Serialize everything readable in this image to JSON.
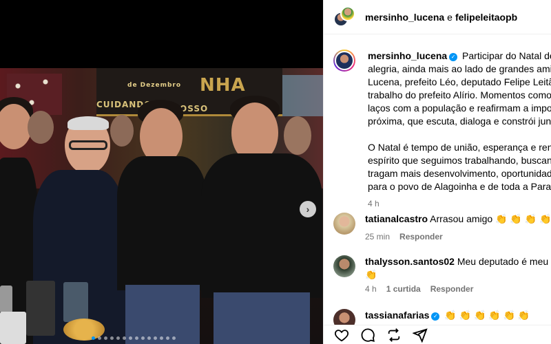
{
  "header": {
    "user1": "mersinho_lucena",
    "conj": "e",
    "user2": "felipeleitaopb"
  },
  "post": {
    "banner_words": [
      "NHA",
      "de Dezembro",
      "CUIDANDO",
      "NOSSO"
    ],
    "caption_username": "mersinho_lucena",
    "caption_lines": [
      "Participar do Natal de Ala",
      "alegria, ainda mais ao lado de grandes amigo",
      "Lucena, prefeito Léo, deputado Felipe Leitão p",
      "trabalho do prefeito Alírio. Momentos como e",
      "laços com a população e reafirmam a importâ",
      "próxima, que escuta, dialoga e constrói junto."
    ],
    "caption_lines2": [
      "O Natal é tempo de união, esperança e renova",
      "espírito que seguimos trabalhando, buscando",
      "tragam mais desenvolvimento, oportunidades",
      "para o povo de Alagoinha e de toda a Paraíba"
    ],
    "caption_time": "4 h"
  },
  "comments": [
    {
      "username": "tatianalcastro",
      "text": "Arrasou amigo 👏 👏 👏 👏",
      "time": "25 min",
      "reply": "Responder"
    },
    {
      "username": "thalysson.santos02",
      "text": "Meu deputado é meu gov",
      "text2": "👏",
      "time": "4 h",
      "likes": "1 curtida",
      "reply": "Responder"
    },
    {
      "username": "tassianafarias",
      "text": "👏 👏 👏 👏 👏 👏"
    }
  ],
  "colors": {
    "verified": "#0095f6",
    "meta_gray": "#737373"
  },
  "icons": [
    "heart-icon",
    "comment-icon",
    "share-icon",
    "send-icon",
    "chevron-right-icon",
    "verified-icon"
  ]
}
